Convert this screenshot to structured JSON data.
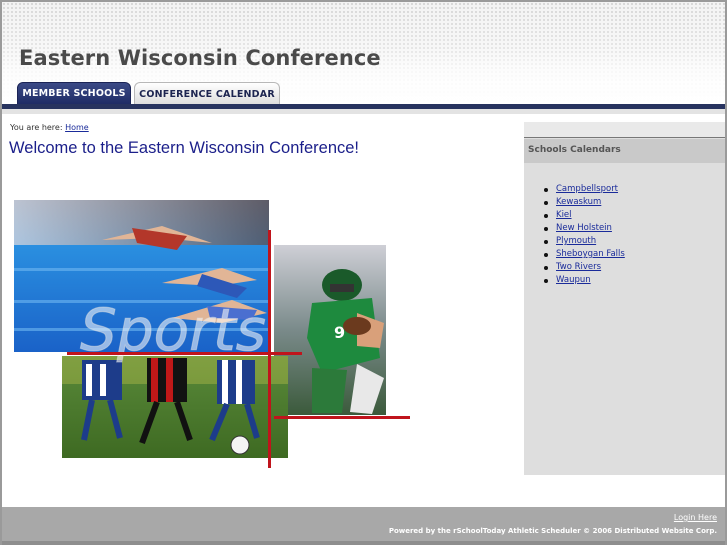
{
  "site": {
    "title": "Eastern Wisconsin Conference"
  },
  "tabs": [
    {
      "label": "MEMBER SCHOOLS"
    },
    {
      "label": "CONFERENCE CALENDAR"
    }
  ],
  "breadcrumb": {
    "prefix": "You are here:",
    "home": "Home"
  },
  "main": {
    "welcome": "Welcome to the Eastern Wisconsin Conference!",
    "image_text": "Sports"
  },
  "sidebar": {
    "title": "Schools Calendars",
    "schools": [
      "Campbellsport",
      "Kewaskum",
      "Kiel",
      "New Holstein",
      "Plymouth",
      "Sheboygan Falls",
      "Two Rivers",
      "Waupun"
    ]
  },
  "footer": {
    "login": "Login Here",
    "credit": "Powered by the rSchoolToday Athletic Scheduler  ©  2006 Distributed Website Corp."
  },
  "colors": {
    "navy": "#27335f",
    "link": "#1a2b9a",
    "welcome": "#1b1f8a",
    "accent_red": "#c0141c"
  }
}
